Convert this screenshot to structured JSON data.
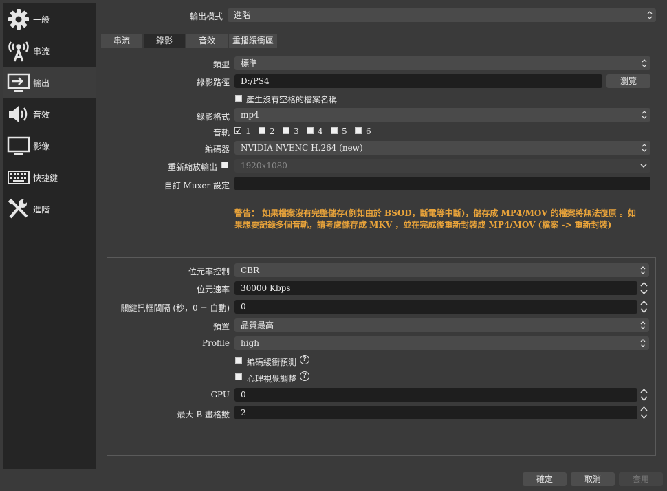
{
  "sidebar": {
    "items": [
      {
        "label": "一般",
        "icon": "gear-icon"
      },
      {
        "label": "串流",
        "icon": "broadcast-antenna-icon"
      },
      {
        "label": "輸出",
        "icon": "monitor-output-icon",
        "active": true
      },
      {
        "label": "音效",
        "icon": "speaker-icon"
      },
      {
        "label": "影像",
        "icon": "monitor-icon"
      },
      {
        "label": "快捷鍵",
        "icon": "keyboard-icon"
      },
      {
        "label": "進階",
        "icon": "tools-icon"
      }
    ]
  },
  "output_mode": {
    "label": "輸出模式",
    "value": "進階"
  },
  "tabs": [
    "串流",
    "錄影",
    "音效",
    "重播緩衝區"
  ],
  "active_tab": "錄影",
  "recording": {
    "type": {
      "label": "類型",
      "value": "標準"
    },
    "path": {
      "label": "錄影路徑",
      "value": "D:/PS4",
      "browse": "瀏覽"
    },
    "no_space": {
      "label": "產生沒有空格的檔案名稱",
      "checked": false
    },
    "format": {
      "label": "錄影格式",
      "value": "mp4"
    },
    "audio_track": {
      "label": "音軌",
      "tracks": [
        "1",
        "2",
        "3",
        "4",
        "5",
        "6"
      ],
      "checked": [
        true,
        false,
        false,
        false,
        false,
        false
      ]
    },
    "encoder": {
      "label": "編碼器",
      "value": "NVIDIA NVENC H.264 (new)"
    },
    "rescale": {
      "label": "重新縮放輸出",
      "checked": false,
      "value": "1920x1080"
    },
    "muxer": {
      "label": "自訂 Muxer 設定",
      "value": ""
    },
    "warning": {
      "line1": "警告： 如果檔案沒有完整儲存(例如由於 BSOD，斷電等中斷)，儲存成 MP4/MOV 的檔案將無法復原 。如",
      "line2": "果想要記錄多個音軌，請考慮儲存成 MKV ，並在完成後重新封裝成 MP4/MOV (檔案 -> 重新封裝)",
      "color": "#e8a33a"
    }
  },
  "encoder_settings": {
    "rate_control": {
      "label": "位元率控制",
      "value": "CBR"
    },
    "bitrate": {
      "label": "位元速率",
      "value": "30000 Kbps"
    },
    "keyframe": {
      "label": "關鍵訊框間隔 (秒，0 = 自動)",
      "value": "0"
    },
    "preset": {
      "label": "預置",
      "value": "品質最高"
    },
    "profile": {
      "label": "Profile",
      "value": "high"
    },
    "lookahead": {
      "label": "編碼緩衝預測",
      "checked": false
    },
    "psycho": {
      "label": "心理視覺調整",
      "checked": false
    },
    "gpu": {
      "label": "GPU",
      "value": "0"
    },
    "bframes": {
      "label": "最大 B 畫格數",
      "value": "2"
    }
  },
  "footer": {
    "ok": "確定",
    "cancel": "取消",
    "apply": "套用"
  }
}
